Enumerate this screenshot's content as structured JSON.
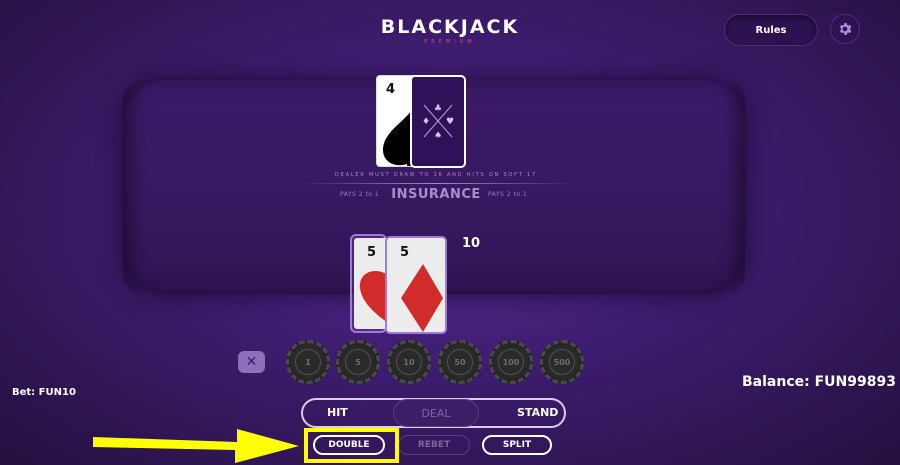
{
  "header": {
    "logo_title": "BLACKJACK",
    "logo_subtitle": "PREMIUM",
    "rules_label": "Rules",
    "settings_icon": "gear-icon"
  },
  "table": {
    "dealer_cards": [
      {
        "rank": "4",
        "suit": "spades",
        "face_up": true
      },
      {
        "face_up": false
      }
    ],
    "rules_text": "DEALER MUST DRAW TO 16 AND HITS ON SOFT 17",
    "insurance": {
      "label": "INSURANCE",
      "pays_left": "PAYS 2 to 1",
      "pays_right": "PAYS 2 to 1"
    },
    "player_cards": [
      {
        "rank": "5",
        "suit": "hearts"
      },
      {
        "rank": "5",
        "suit": "diamonds"
      }
    ],
    "player_total": "10"
  },
  "chips": {
    "clear_icon": "close-icon",
    "values": [
      "1",
      "5",
      "10",
      "50",
      "100",
      "500"
    ]
  },
  "bet": {
    "label": "Bet: FUN10"
  },
  "balance": {
    "label": "Balance: FUN99893"
  },
  "actions": {
    "hit": "HIT",
    "deal": "DEAL",
    "stand": "STAND",
    "double": "DOUBLE",
    "rebet": "REBET",
    "split": "SPLIT"
  },
  "colors": {
    "background": "#3d1c6e",
    "table": "#36185f",
    "highlight": "#ffff00",
    "logo_subtitle": "#e2477d"
  }
}
